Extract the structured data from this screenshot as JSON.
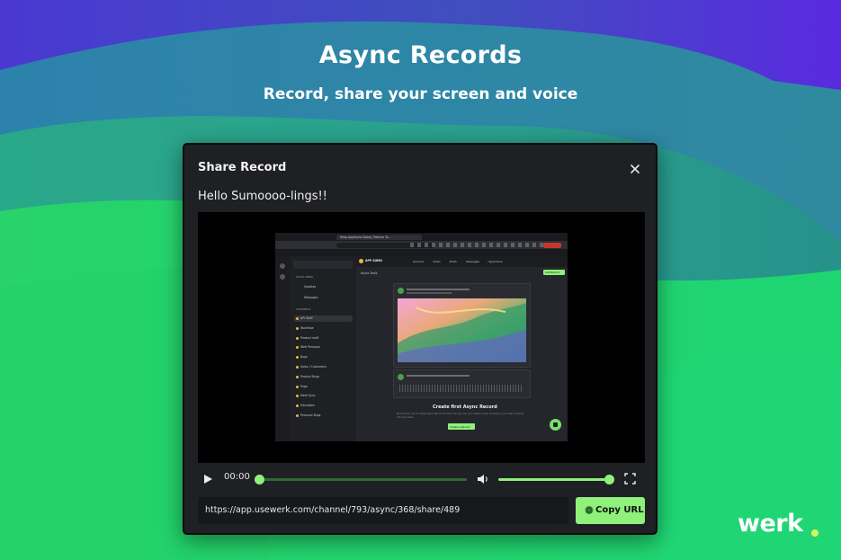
{
  "hero": {
    "title": "Async Records",
    "subtitle": "Record, share your screen and voice"
  },
  "modal": {
    "title": "Share Record",
    "message": "Hello Sumoooo-lings!!",
    "close_icon": "close-icon"
  },
  "video": {
    "current_time": "00:00",
    "progress": 0,
    "volume": 1.0,
    "icons": [
      "play-icon",
      "volume-icon",
      "fullscreen-icon"
    ],
    "preview": {
      "workspace": "APP SUMO",
      "tabs": [
        "General",
        "Video",
        "Posts",
        "Messages",
        "Hyperdiscs"
      ],
      "channel_header": "Async Tools",
      "add_button": "Add Record",
      "quick_menu_label": "QUICK MENU",
      "quick_menu": [
        "Updates",
        "Messages"
      ],
      "channels_label": "CHANNELS",
      "channels": [
        "API Stuff",
        "Workflow",
        "Product stuff",
        "Web Personal",
        "Bugs",
        "Sales / Customers",
        "Product Bugs",
        "Page",
        "Meet Sync",
        "Education",
        "Personal Bugs"
      ],
      "empty_title": "Create first Async Record",
      "empty_desc": "Be the first one to create Async Record for this channel. You can create screen records to your team to share info and ideas.",
      "create_button": "Create a Record",
      "browser_tab": "Shop AppSumo Deals | Reduce To..."
    }
  },
  "share": {
    "url": "https://app.usewerk.com/channel/793/async/368/share/489",
    "copy_label": "Copy URL"
  },
  "brand": {
    "name": "werk"
  },
  "colors": {
    "accent": "#8ff07a",
    "modal_bg": "#1f2024",
    "brand_dot": "#d8f75d"
  }
}
